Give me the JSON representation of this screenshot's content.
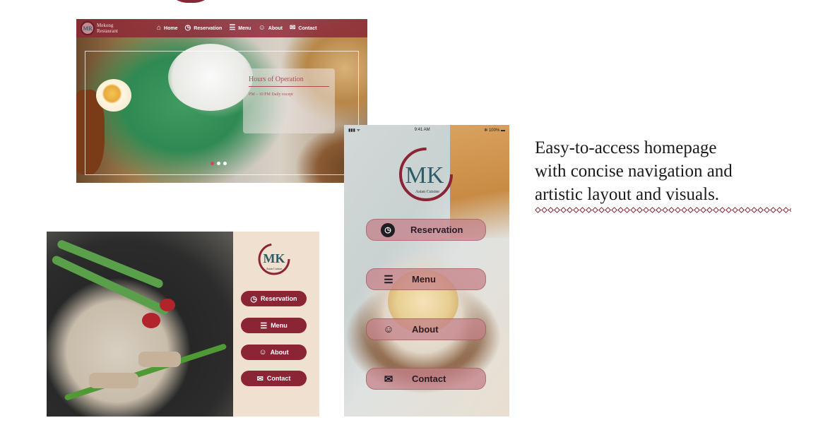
{
  "caption": {
    "line1": "Easy-to-access homepage",
    "line2": "with concise navigation and",
    "line3": "artistic layout and visuals."
  },
  "desktop": {
    "logo": {
      "mark": "MR",
      "line1": "Mekong",
      "line2": "Restaurant"
    },
    "nav": [
      {
        "label": "Home",
        "icon": "bank-icon",
        "glyph": "⌂"
      },
      {
        "label": "Reservation",
        "icon": "clock-icon",
        "glyph": "◷"
      },
      {
        "label": "Menu",
        "icon": "clipboard-icon",
        "glyph": "☰"
      },
      {
        "label": "About",
        "icon": "smiley-icon",
        "glyph": "☺"
      },
      {
        "label": "Contact",
        "icon": "chat-icon",
        "glyph": "✉"
      }
    ],
    "hours_title": "Hours of Operation",
    "hours_text": "PM – 10 PM Daily except",
    "slides": {
      "count": 3,
      "active": 0
    }
  },
  "tablet": {
    "logo": {
      "mark": "MK",
      "tagline": "Asian Cuisine"
    },
    "buttons": [
      {
        "label": "Reservation",
        "icon": "clock-icon",
        "glyph": "◷"
      },
      {
        "label": "Menu",
        "icon": "clipboard-icon",
        "glyph": "☰"
      },
      {
        "label": "About",
        "icon": "smiley-icon",
        "glyph": "☺"
      },
      {
        "label": "Contact",
        "icon": "chat-icon",
        "glyph": "✉"
      }
    ]
  },
  "phone": {
    "status": {
      "signal": "▮▮▮ ᯤ",
      "time": "9:41 AM",
      "battery": "✻ 100% ▬"
    },
    "logo": {
      "mark": "MK",
      "tagline": "Asian Cuisine"
    },
    "buttons": [
      {
        "label": "Reservation",
        "icon": "clock-icon",
        "glyph": "◷"
      },
      {
        "label": "Menu",
        "icon": "clipboard-icon",
        "glyph": "☰"
      },
      {
        "label": "About",
        "icon": "smiley-icon",
        "glyph": "☺"
      },
      {
        "label": "Contact",
        "icon": "chat-icon",
        "glyph": "✉"
      }
    ]
  },
  "colors": {
    "brand": "#8b2435",
    "cream": "#f0e0cf",
    "phone_button": "#c48088"
  }
}
